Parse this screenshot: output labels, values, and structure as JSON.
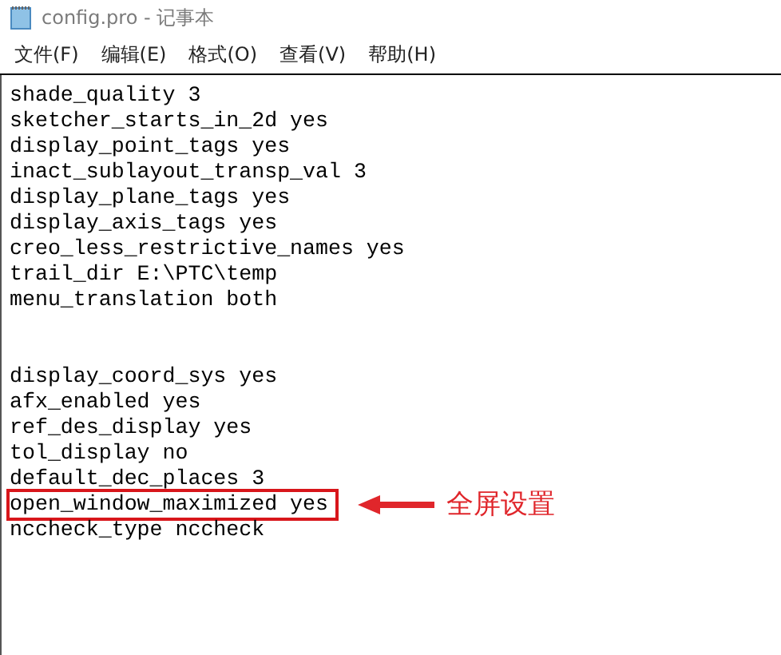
{
  "window": {
    "title": "config.pro - 记事本"
  },
  "menu": [
    "文件(F)",
    "编辑(E)",
    "格式(O)",
    "查看(V)",
    "帮助(H)"
  ],
  "editor": {
    "blocks": [
      {
        "lines": [
          {
            "text": "shade_quality 3",
            "highlighted": false
          },
          {
            "text": "sketcher_starts_in_2d yes",
            "highlighted": false
          },
          {
            "text": "display_point_tags yes",
            "highlighted": false
          },
          {
            "text": "inact_sublayout_transp_val 3",
            "highlighted": false
          },
          {
            "text": "display_plane_tags yes",
            "highlighted": false
          },
          {
            "text": "display_axis_tags yes",
            "highlighted": false
          },
          {
            "text": "creo_less_restrictive_names yes",
            "highlighted": false
          },
          {
            "text": "trail_dir E:\\PTC\\temp",
            "highlighted": false
          },
          {
            "text": "menu_translation both",
            "highlighted": false
          }
        ]
      },
      {
        "lines": [
          {
            "text": "display_coord_sys yes",
            "highlighted": false
          },
          {
            "text": "afx_enabled yes",
            "highlighted": false
          },
          {
            "text": "ref_des_display yes",
            "highlighted": false
          },
          {
            "text": "tol_display no",
            "highlighted": false
          },
          {
            "text": "default_dec_places 3",
            "highlighted": false
          },
          {
            "text": "open_window_maximized yes",
            "highlighted": true
          },
          {
            "text": "nccheck_type nccheck",
            "highlighted": false
          }
        ]
      }
    ]
  },
  "annotation": {
    "text": "全屏设置"
  }
}
